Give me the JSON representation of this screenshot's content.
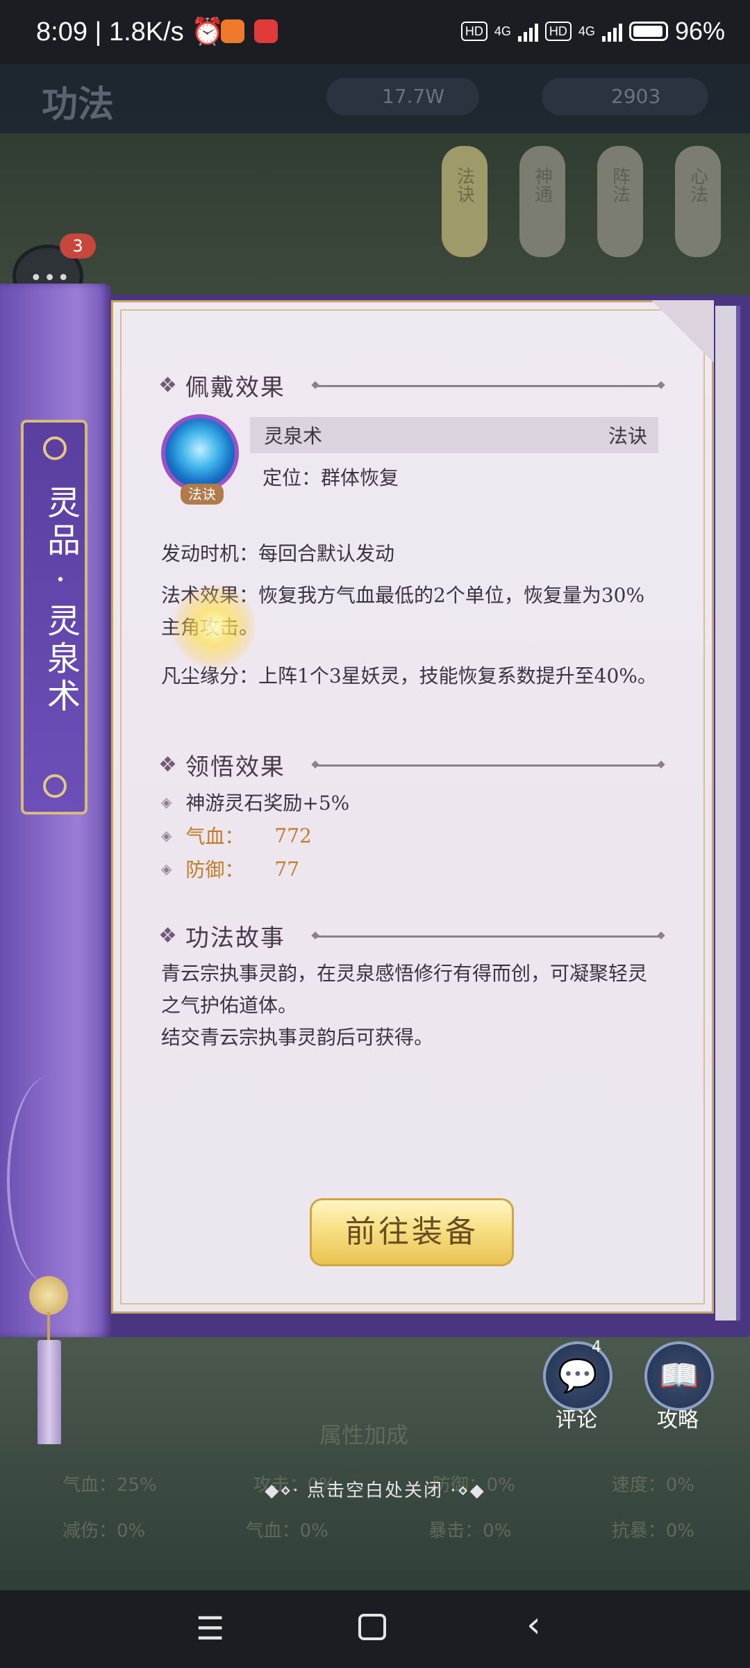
{
  "status_bar": {
    "time": "8:09",
    "net_speed": "1.8K/s",
    "hd1": "HD",
    "net1": "4G",
    "hd2": "HD",
    "net2": "4G",
    "battery": "96%"
  },
  "background": {
    "page_title": "功法",
    "resource1": "17.7W",
    "resource2": "2903",
    "tabs": [
      "法诀",
      "神通",
      "阵法",
      "心法"
    ],
    "chat_badge": "3",
    "attr_heading": "属性加成",
    "attr_row1": [
      "气血：25%",
      "攻击：0%",
      "防御：0%",
      "速度：0%"
    ],
    "attr_row2": [
      "减伤：0%",
      "气血：0%",
      "暴击：0%",
      "抗暴：0%"
    ]
  },
  "spine": {
    "title": "灵品·灵泉术"
  },
  "wear_effect": {
    "heading": "佩戴效果",
    "skill_name": "灵泉术",
    "skill_type": "法诀",
    "icon_tag": "法诀",
    "position": "定位：群体恢复",
    "trigger": "发动时机：每回合默认发动",
    "effect": "法术效果：恢复我方气血最低的2个单位，恢复量为30%主角攻击。",
    "fate": "凡尘缘分：上阵1个3星妖灵，技能恢复系数提升至40%。"
  },
  "insight_effect": {
    "heading": "领悟效果",
    "bonus": "神游灵石奖励+5%",
    "stats": [
      {
        "label": "气血：",
        "value": "772"
      },
      {
        "label": "防御：",
        "value": "77"
      }
    ]
  },
  "story": {
    "heading": "功法故事",
    "text1": "青云宗执事灵韵，在灵泉感悟修行有得而创，可凝聚轻灵之气护佑道体。",
    "text2": "结交青云宗执事灵韵后可获得。"
  },
  "equip_button": "前往装备",
  "actions": {
    "comment_label": "评论",
    "comment_badge": "4",
    "guide_label": "攻略"
  },
  "close_hint": "◆⋄· 点击空白处关闭 ·⋄◆",
  "icons": {
    "comment": "speech-bubble",
    "guide": "open-book",
    "nav_menu": "menu",
    "nav_home": "square",
    "nav_back": "chevron-left"
  }
}
